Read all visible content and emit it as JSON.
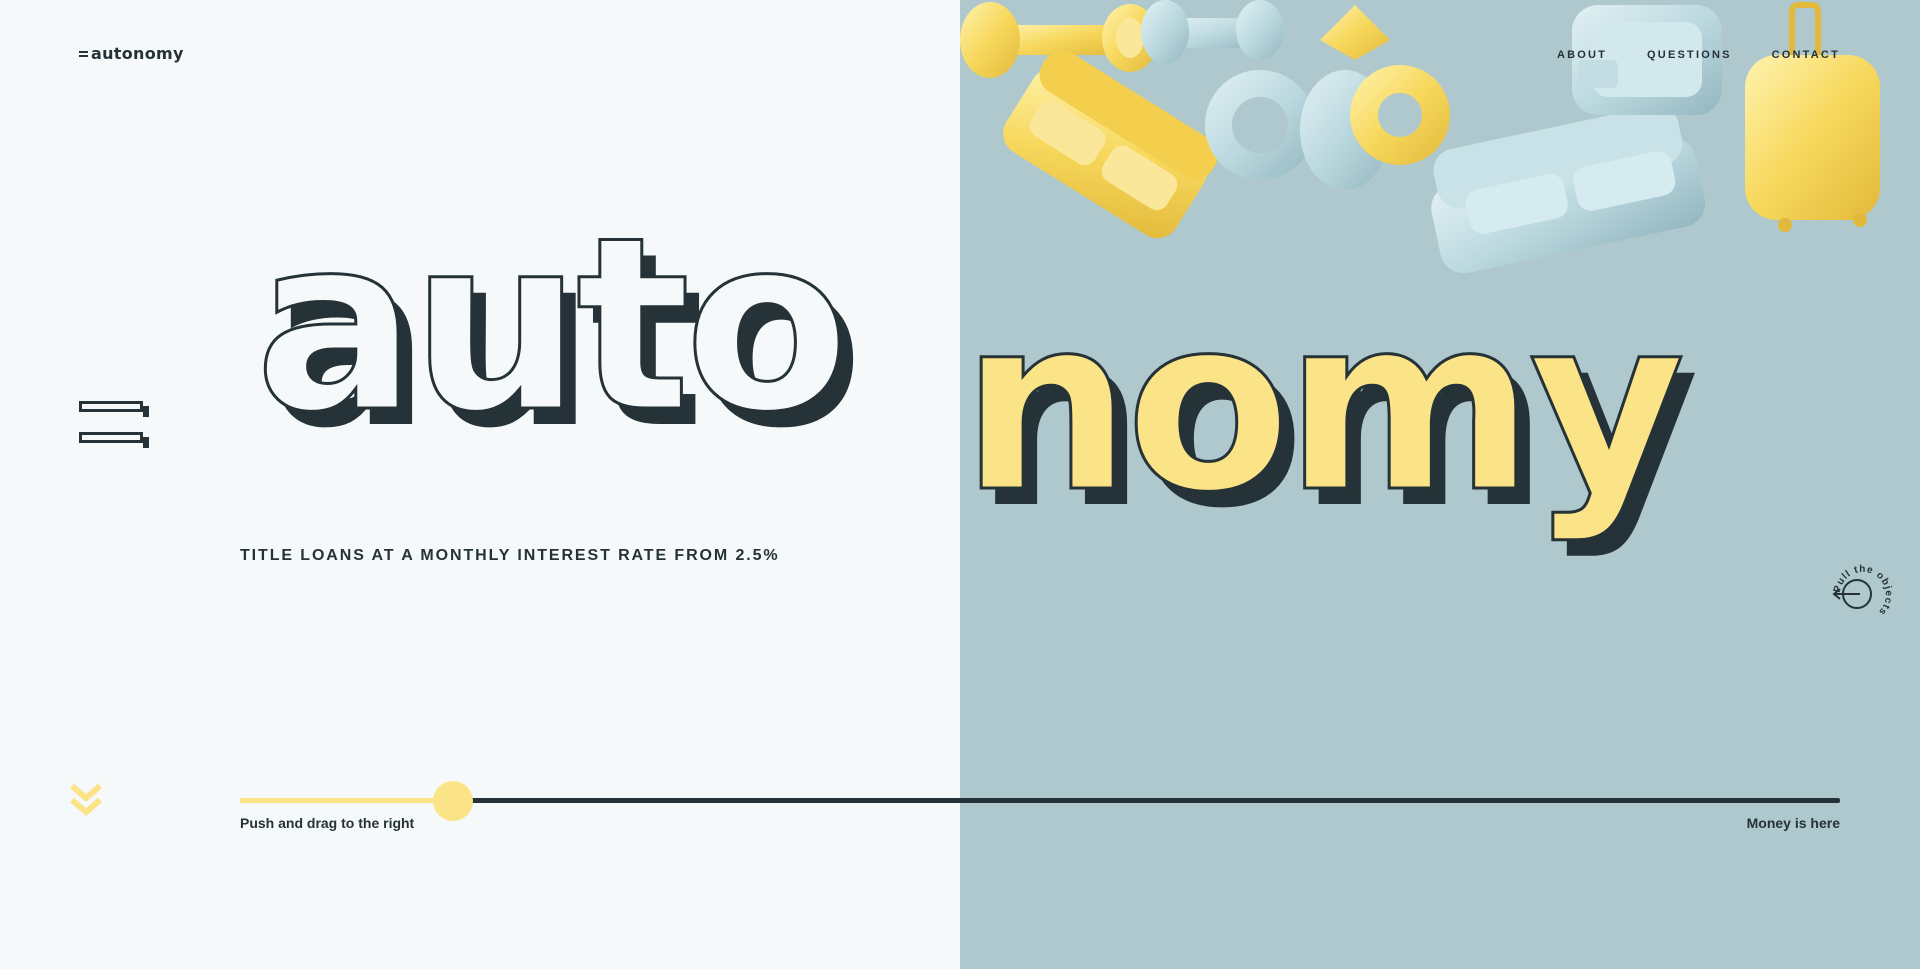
{
  "brand": {
    "logo_text": "autonomy"
  },
  "nav": {
    "about": "ABOUT",
    "questions": "QUESTIONS",
    "contact": "CONTACT"
  },
  "hero": {
    "headline_left": "auto",
    "headline_right": "nomy",
    "tagline": "TITLE LOANS AT A MONTHLY INTEREST RATE FROM 2.5%"
  },
  "slider": {
    "left_label": "Push and drag to the right",
    "right_label": "Money is here",
    "progress": 0.133
  },
  "pull_hint": {
    "text": "Pull the objects"
  },
  "objects": [
    {
      "name": "dumbbell",
      "color": "yellow"
    },
    {
      "name": "dumbbell",
      "color": "blue"
    },
    {
      "name": "ring",
      "color": "yellow"
    },
    {
      "name": "ring",
      "color": "blue"
    },
    {
      "name": "sofa",
      "color": "yellow"
    },
    {
      "name": "sofa",
      "color": "blue"
    },
    {
      "name": "tv",
      "color": "blue"
    },
    {
      "name": "suitcase",
      "color": "yellow"
    }
  ],
  "icons": {
    "menu": "menu-bars-icon",
    "scroll": "double-chevron-down-icon",
    "pull": "circle-arrow-left-icon"
  },
  "colors": {
    "dark": "#253237",
    "light_bg": "#f6f9fa",
    "blue_bg": "#aec8ce",
    "yellow": "#fbe387",
    "object_yellow": "#f7d85c",
    "object_blue": "#bcd9e0"
  }
}
